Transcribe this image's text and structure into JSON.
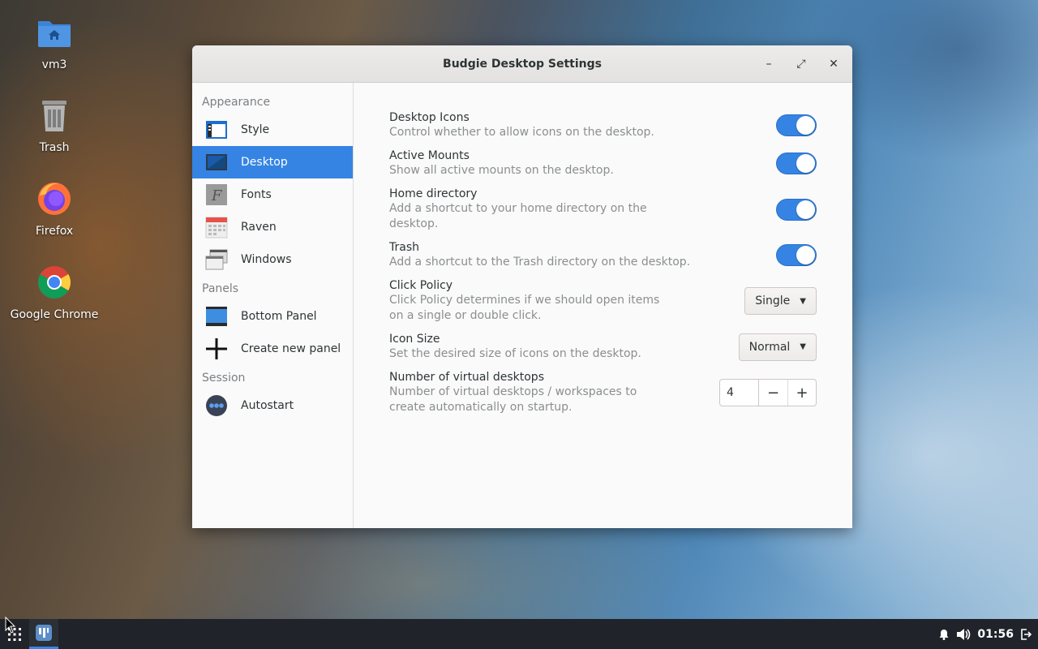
{
  "desktop": {
    "icons": [
      {
        "label": "vm3",
        "icon": "home-folder-icon"
      },
      {
        "label": "Trash",
        "icon": "trash-icon"
      },
      {
        "label": "Firefox",
        "icon": "firefox-icon"
      },
      {
        "label": "Google Chrome",
        "icon": "chrome-icon"
      }
    ]
  },
  "window": {
    "title": "Budgie Desktop Settings",
    "controls": {
      "minimize": "–",
      "maximize": "⤢",
      "close": "✕"
    }
  },
  "sidebar": {
    "sections": [
      {
        "header": "Appearance",
        "items": [
          "Style",
          "Desktop",
          "Fonts",
          "Raven",
          "Windows"
        ]
      },
      {
        "header": "Panels",
        "items": [
          "Bottom Panel",
          "Create new panel"
        ]
      },
      {
        "header": "Session",
        "items": [
          "Autostart"
        ]
      }
    ],
    "selected": "Desktop"
  },
  "settings": {
    "desktop_icons": {
      "title": "Desktop Icons",
      "desc": "Control whether to allow icons on the desktop.",
      "enabled": true
    },
    "active_mounts": {
      "title": "Active Mounts",
      "desc": "Show all active mounts on the desktop.",
      "enabled": true
    },
    "home_directory": {
      "title": "Home directory",
      "desc": "Add a shortcut to your home directory on the desktop.",
      "enabled": true
    },
    "trash": {
      "title": "Trash",
      "desc": "Add a shortcut to the Trash directory on the desktop.",
      "enabled": true
    },
    "click_policy": {
      "title": "Click Policy",
      "desc": "Click Policy determines if we should open items on a single or double click.",
      "value": "Single"
    },
    "icon_size": {
      "title": "Icon Size",
      "desc": "Set the desired size of icons on the desktop.",
      "value": "Normal"
    },
    "virtual_desktops": {
      "title": "Number of virtual desktops",
      "desc": "Number of virtual desktops / workspaces to create automatically on startup.",
      "value": "4",
      "minus": "−",
      "plus": "+"
    }
  },
  "panel": {
    "clock": "01:56"
  },
  "colors": {
    "accent": "#3584e4",
    "panel": "#202329"
  }
}
